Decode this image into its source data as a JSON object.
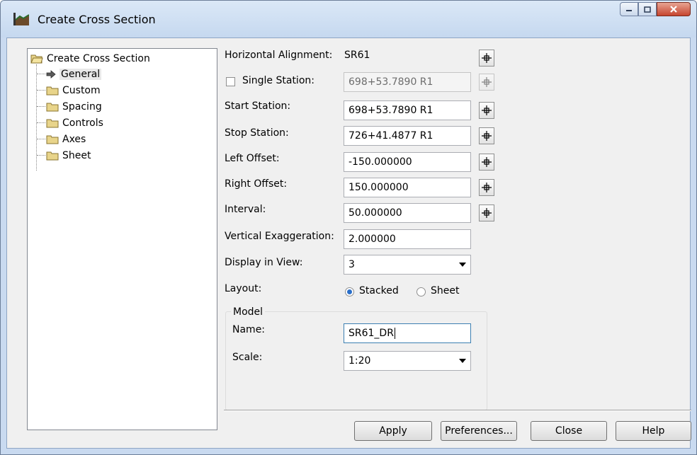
{
  "window": {
    "title": "Create Cross Section"
  },
  "tree": {
    "root": "Create Cross Section",
    "items": [
      "General",
      "Custom",
      "Spacing",
      "Controls",
      "Axes",
      "Sheet"
    ]
  },
  "form": {
    "horizontal_alignment": {
      "label": "Horizontal Alignment:",
      "value": "SR61"
    },
    "single_station": {
      "label": "Single Station:",
      "value": "698+53.7890 R1",
      "checked": false
    },
    "start_station": {
      "label": "Start Station:",
      "value": "698+53.7890 R1"
    },
    "stop_station": {
      "label": "Stop Station:",
      "value": "726+41.4877 R1"
    },
    "left_offset": {
      "label": "Left Offset:",
      "value": "-150.000000"
    },
    "right_offset": {
      "label": "Right Offset:",
      "value": "150.000000"
    },
    "interval": {
      "label": "Interval:",
      "value": "50.000000"
    },
    "vertical_exaggeration": {
      "label": "Vertical Exaggeration:",
      "value": "2.000000"
    },
    "display_in_view": {
      "label": "Display in View:",
      "value": "3"
    },
    "layout": {
      "label": "Layout:",
      "options": [
        "Stacked",
        "Sheet"
      ],
      "selected": "Stacked"
    }
  },
  "model": {
    "group_label": "Model",
    "name": {
      "label": "Name:",
      "value": "SR61_DR"
    },
    "scale": {
      "label": "Scale:",
      "value": "1:20"
    }
  },
  "buttons": {
    "apply": "Apply",
    "preferences": "Preferences...",
    "close": "Close",
    "help": "Help"
  },
  "colors": {
    "title_bar": "#c5d8ef",
    "dialog_bg": "#f0f0f0",
    "close_button": "#c6452f",
    "radio_accent": "#2a6fc9"
  }
}
